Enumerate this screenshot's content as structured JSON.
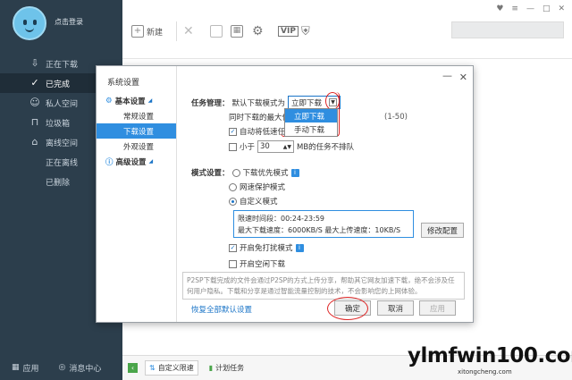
{
  "sidebar": {
    "login_label": "点击登录",
    "items": [
      {
        "label": "正在下载",
        "icon": "download-icon"
      },
      {
        "label": "已完成",
        "icon": "check-circle-icon"
      },
      {
        "label": "私人空间",
        "icon": "person-icon"
      },
      {
        "label": "垃圾箱",
        "icon": "trash-icon"
      },
      {
        "label": "离线空间",
        "icon": "cloud-icon"
      },
      {
        "label": "正在离线",
        "icon": ""
      },
      {
        "label": "已删除",
        "icon": ""
      }
    ],
    "bottom": {
      "apps_label": "应用",
      "messages_label": "消息中心"
    }
  },
  "toolbar": {
    "new_label": "新建",
    "vip_label": "VIP",
    "search_placeholder": ""
  },
  "bottombar": {
    "speed_limit_label": "自定义限速",
    "scheduled_label": "计划任务"
  },
  "watermark": {
    "main": "ylmfwin100.com",
    "sub": "xitongcheng.com"
  },
  "dialog": {
    "title": "系统设置",
    "nav": {
      "group1": "基本设置",
      "items": [
        "常规设置",
        "下载设置",
        "外观设置"
      ],
      "group2": "高级设置"
    },
    "task_mgmt": {
      "label": "任务管理：",
      "default_mode_label": "默认下载模式为",
      "selected": "立即下载",
      "options": [
        "立即下载",
        "手动下载"
      ],
      "max_tasks_label": "同时下载的最大任",
      "max_tasks_range": "(1-50)",
      "auto_lower_label": "自动将低速任",
      "auto_lower_checked": true,
      "smaller_than_label": "小于",
      "smaller_than_value": "30",
      "smaller_than_suffix": "MB的任务不排队",
      "smaller_than_checked": false
    },
    "mode": {
      "label": "模式设置：",
      "options": [
        "下载优先模式",
        "网速保护模式",
        "自定义模式"
      ],
      "selected": "自定义模式",
      "speed_box": {
        "line1": "限速时间段：00:24-23:59",
        "line2": "最大下载速度：6000KB/S 最大上传速度：10KB/S"
      },
      "modify_label": "修改配置",
      "no_disturb_label": "开启免打扰模式",
      "no_disturb_checked": true,
      "idle_download_label": "开启空闲下载",
      "idle_download_checked": false
    },
    "notice": "P2SP下载完成的文件会通过P2SP的方式上传分享，帮助其它网友加速下载，绝不会涉及任何用户隐私。下载和分享是通过智能流量控制的技术，不会影响您的上网体验。",
    "restore_label": "恢复全部默认设置",
    "ok_label": "确定",
    "cancel_label": "取消",
    "apply_label": "应用"
  }
}
